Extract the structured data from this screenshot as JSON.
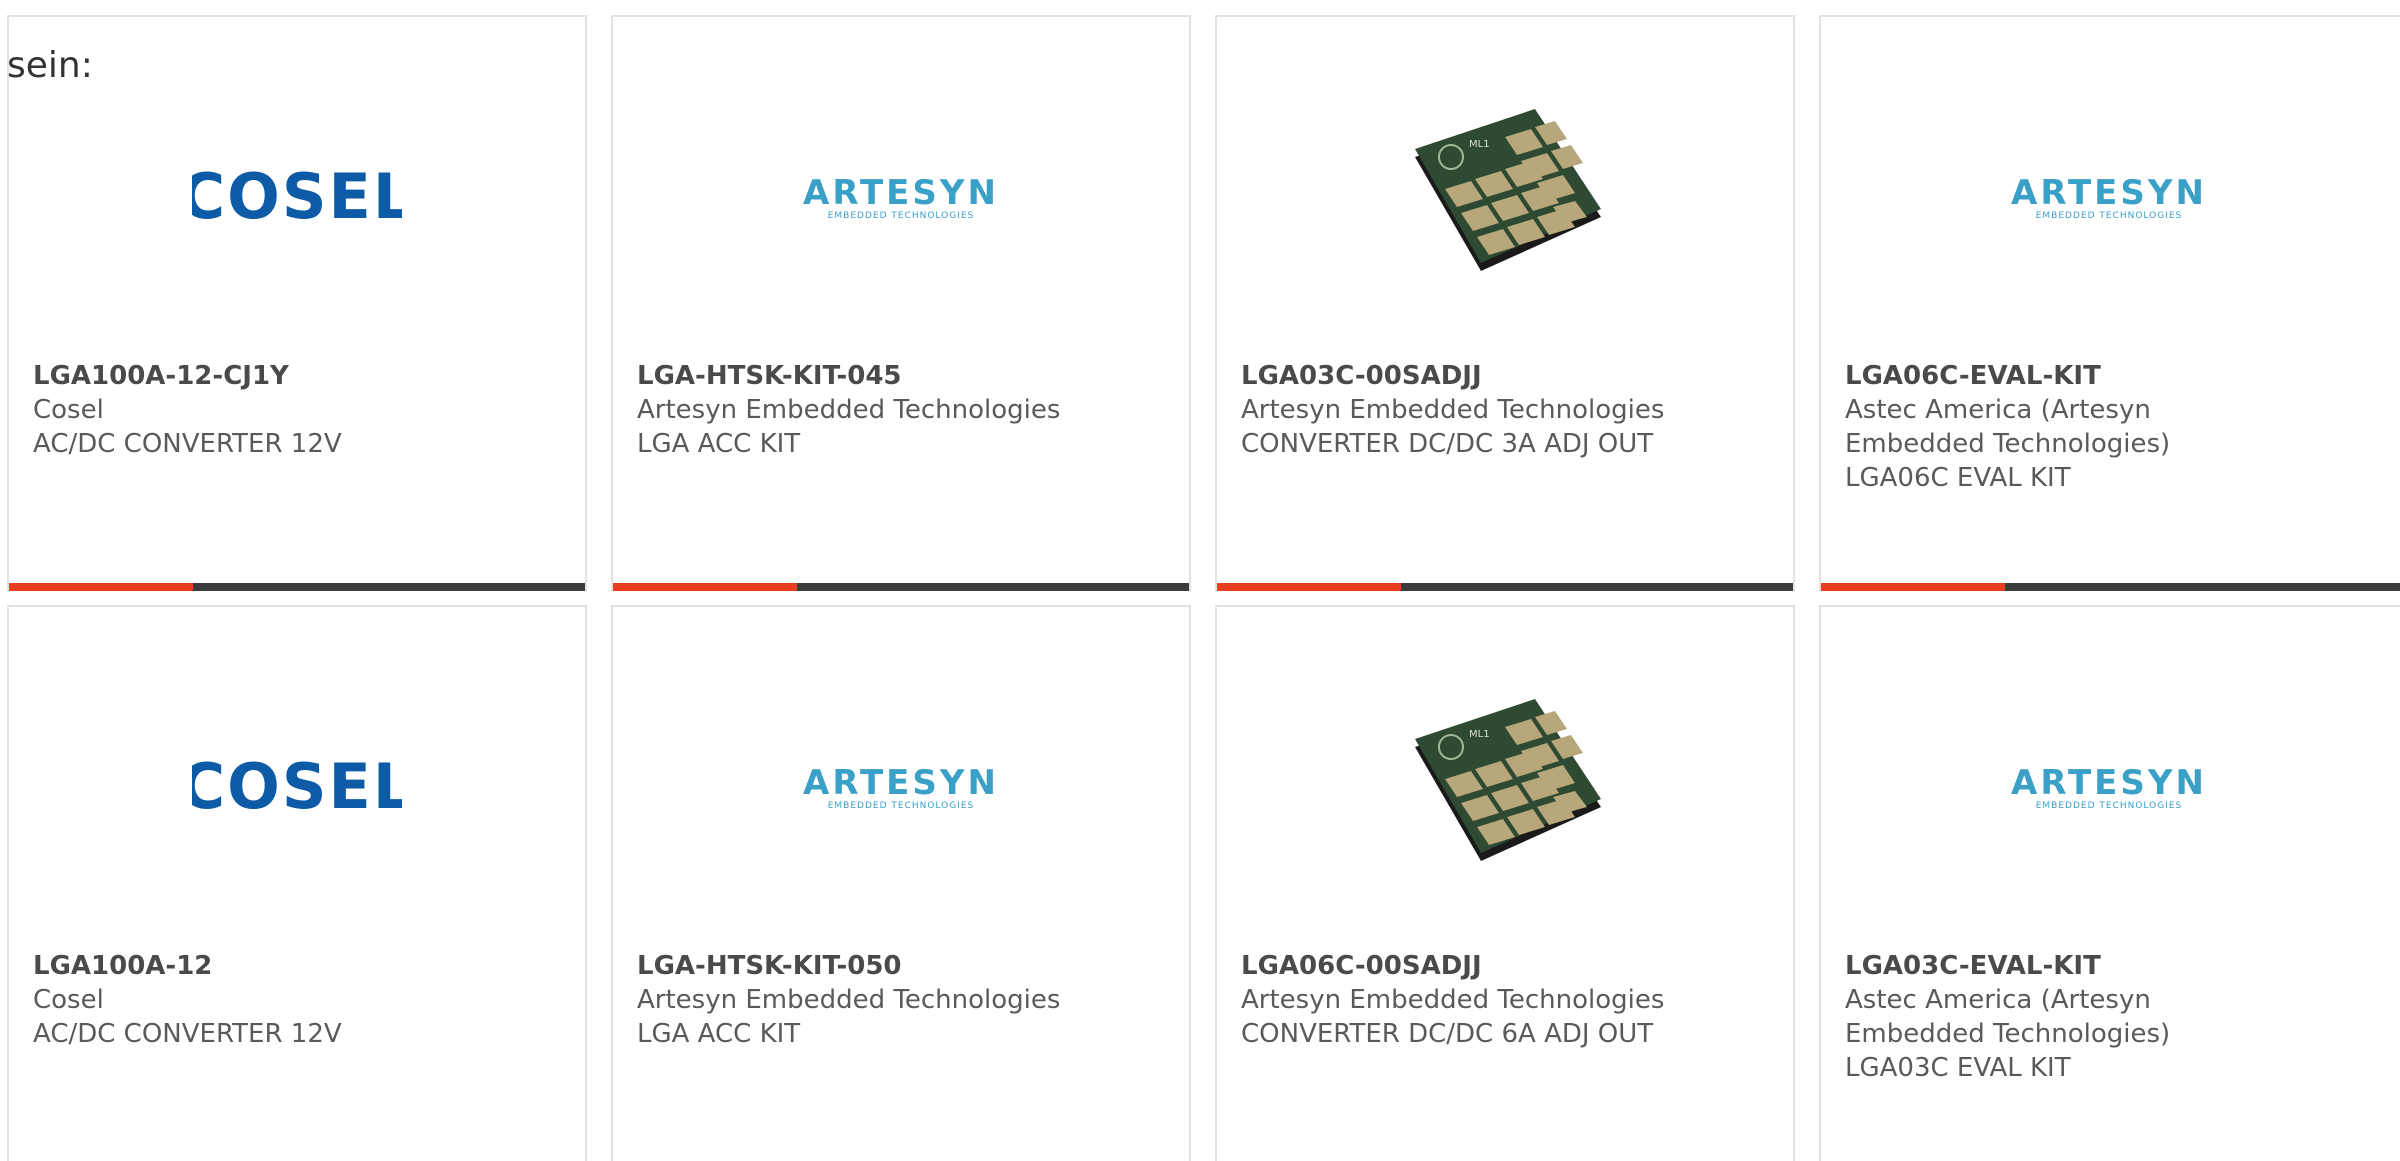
{
  "intro_text": "sein:",
  "colors": {
    "accent": "#e8411c",
    "bar": "#3c3c3c",
    "cosel_blue": "#0d5aa7",
    "artesyn_blue": "#3aa0c8",
    "chip_green": "#2e4a32",
    "chip_pad": "#b8a77a"
  },
  "products": [
    {
      "part_number": "LGA100A-12-CJ1Y",
      "manufacturer": "Cosel",
      "description": "AC/DC CONVERTER 12V",
      "image": "cosel-logo",
      "logo_text": "COSEL"
    },
    {
      "part_number": "LGA-HTSK-KIT-045",
      "manufacturer": "Artesyn Embedded Technologies",
      "description": "LGA ACC KIT",
      "image": "artesyn-logo",
      "logo_text": "ARTESYN",
      "logo_sub": "EMBEDDED TECHNOLOGIES"
    },
    {
      "part_number": "LGA03C-00SADJJ",
      "manufacturer": "Artesyn Embedded Technologies",
      "description": "CONVERTER DC/DC 3A ADJ OUT",
      "image": "chip-module-photo"
    },
    {
      "part_number": "LGA06C-EVAL-KIT",
      "manufacturer": "Astec America (Artesyn Embedded Technologies)",
      "description": "LGA06C EVAL KIT",
      "image": "artesyn-logo",
      "logo_text": "ARTESYN",
      "logo_sub": "EMBEDDED TECHNOLOGIES"
    },
    {
      "part_number": "LGA100A-12",
      "manufacturer": "Cosel",
      "description": "AC/DC CONVERTER 12V",
      "image": "cosel-logo",
      "logo_text": "COSEL"
    },
    {
      "part_number": "LGA-HTSK-KIT-050",
      "manufacturer": "Artesyn Embedded Technologies",
      "description": "LGA ACC KIT",
      "image": "artesyn-logo",
      "logo_text": "ARTESYN",
      "logo_sub": "EMBEDDED TECHNOLOGIES"
    },
    {
      "part_number": "LGA06C-00SADJJ",
      "manufacturer": "Artesyn Embedded Technologies",
      "description": "CONVERTER DC/DC 6A ADJ OUT",
      "image": "chip-module-photo"
    },
    {
      "part_number": "LGA03C-EVAL-KIT",
      "manufacturer": "Astec America (Artesyn Embedded Technologies)",
      "description": "LGA03C EVAL KIT",
      "image": "artesyn-logo",
      "logo_text": "ARTESYN",
      "logo_sub": "EMBEDDED TECHNOLOGIES"
    }
  ]
}
